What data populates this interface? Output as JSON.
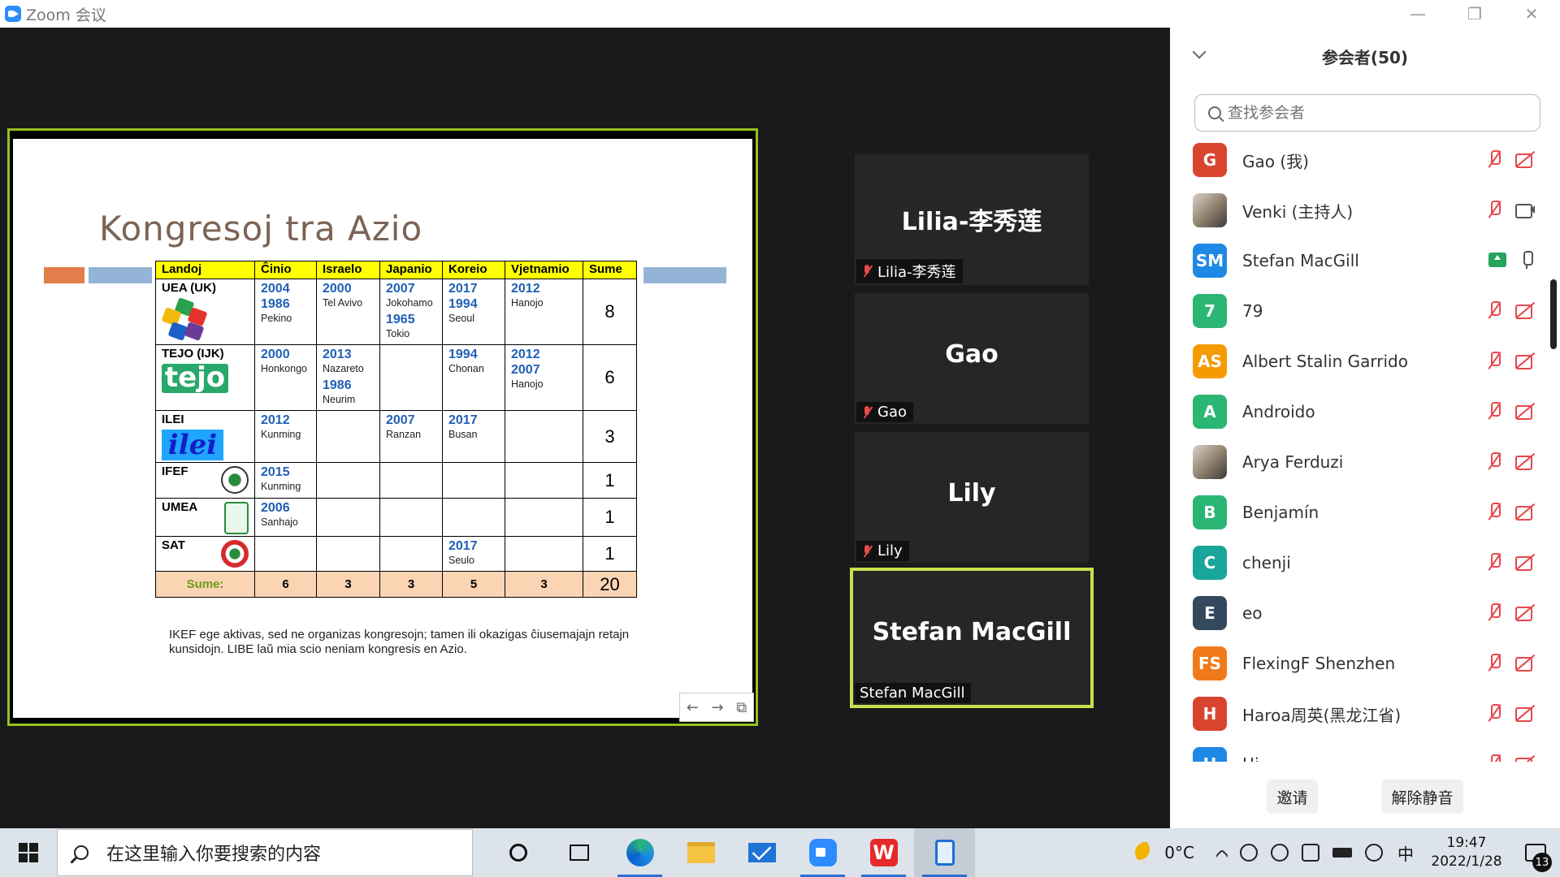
{
  "window": {
    "title": "Zoom 会议"
  },
  "slide": {
    "title": "Kongresoj tra Azio",
    "headers": [
      "Landoj",
      "Ĉinio",
      "Israelo",
      "Japanio",
      "Koreio",
      "Vjetnamio",
      "Sume"
    ],
    "rows": [
      {
        "org": "UEA (UK)",
        "cinio": [
          [
            "2004",
            ""
          ],
          [
            "1986",
            "Pekino"
          ]
        ],
        "israelo": [
          [
            "2000",
            "Tel Avivo"
          ]
        ],
        "japanio": [
          [
            "2007",
            "Jokohamo"
          ],
          [
            "1965",
            "Tokio"
          ]
        ],
        "koreio": [
          [
            "2017",
            ""
          ],
          [
            "1994",
            "Seoul"
          ]
        ],
        "vjetnamio": [
          [
            "2012",
            "Hanojo"
          ]
        ],
        "sume": "8"
      },
      {
        "org": "TEJO (IJK)",
        "logo_text": "tejo",
        "cinio": [
          [
            "2000",
            "Honkongo"
          ]
        ],
        "israelo": [
          [
            "2013",
            "Nazareto"
          ],
          [
            "1986",
            "Neurim"
          ]
        ],
        "japanio": [],
        "koreio": [
          [
            "1994",
            "Chonan"
          ]
        ],
        "vjetnamio": [
          [
            "2012",
            ""
          ],
          [
            "2007",
            "Hanojo"
          ]
        ],
        "sume": "6"
      },
      {
        "org": "ILEI",
        "logo_text": "ilei",
        "cinio": [
          [
            "2012",
            "Kunming"
          ]
        ],
        "israelo": [],
        "japanio": [
          [
            "2007",
            "Ranzan"
          ]
        ],
        "koreio": [
          [
            "2017",
            "Busan"
          ]
        ],
        "vjetnamio": [],
        "sume": "3"
      },
      {
        "org": "IFEF",
        "cinio": [
          [
            "2015",
            "Kunming"
          ]
        ],
        "israelo": [],
        "japanio": [],
        "koreio": [],
        "vjetnamio": [],
        "sume": "1"
      },
      {
        "org": "UMEA",
        "cinio": [
          [
            "2006",
            "Sanhajo"
          ]
        ],
        "israelo": [],
        "japanio": [],
        "koreio": [],
        "vjetnamio": [],
        "sume": "1"
      },
      {
        "org": "SAT",
        "cinio": [],
        "israelo": [],
        "japanio": [],
        "koreio": [
          [
            "2017",
            "Seulo"
          ]
        ],
        "vjetnamio": [],
        "sume": "1"
      }
    ],
    "totals": {
      "label": "Sume:",
      "values": [
        "6",
        "3",
        "3",
        "5",
        "3"
      ],
      "grand": "20"
    },
    "note": "IKEF ege aktivas, sed ne organizas kongresojn; tamen ili okazigas ĉiusemajajn retajn kunsidojn. LIBE laŭ mia scio neniam kongresis en Azio."
  },
  "tiles": [
    {
      "name": "Lilia-李秀莲",
      "label": "Lilia-李秀莲",
      "muted": true
    },
    {
      "name": "Gao",
      "label": "Gao",
      "muted": true
    },
    {
      "name": "Lily",
      "label": "Lily",
      "muted": true
    },
    {
      "name": "Stefan MacGill",
      "label": "Stefan MacGill",
      "muted": false
    }
  ],
  "panel": {
    "title": "参会者(50)",
    "search_placeholder": "查找参会者",
    "participants": [
      {
        "initials": "G",
        "name": "Gao (我)",
        "color": "#d9442f",
        "mic": "off",
        "cam": "off"
      },
      {
        "initials": "",
        "name": "Venki (主持人)",
        "color": "",
        "photo": true,
        "mic": "off",
        "cam": "on"
      },
      {
        "initials": "SM",
        "name": "Stefan MacGill",
        "color": "#1e88e5",
        "mic": "on",
        "cam": "share"
      },
      {
        "initials": "7",
        "name": "79",
        "color": "#2bb673",
        "mic": "off",
        "cam": "off"
      },
      {
        "initials": "AS",
        "name": "Albert Stalin Garrido",
        "color": "#f59b00",
        "mic": "off",
        "cam": "off"
      },
      {
        "initials": "A",
        "name": "Androido",
        "color": "#2bb673",
        "mic": "off",
        "cam": "off"
      },
      {
        "initials": "",
        "name": "Arya Ferduzi",
        "color": "",
        "photo": true,
        "mic": "off",
        "cam": "off"
      },
      {
        "initials": "B",
        "name": "Benjamín",
        "color": "#2bb673",
        "mic": "off",
        "cam": "off"
      },
      {
        "initials": "C",
        "name": "chenji",
        "color": "#1aa59a",
        "mic": "off",
        "cam": "off"
      },
      {
        "initials": "E",
        "name": "eo",
        "color": "#34495e",
        "mic": "off",
        "cam": "off"
      },
      {
        "initials": "FS",
        "name": "FlexingF Shenzhen",
        "color": "#f07a1a",
        "mic": "off",
        "cam": "off"
      },
      {
        "initials": "H",
        "name": "Haroa周英(黑龙江省)",
        "color": "#d9442f",
        "mic": "off",
        "cam": "off"
      },
      {
        "initials": "H",
        "name": "Hi...",
        "color": "#1e88e5",
        "mic": "off",
        "cam": "off"
      }
    ],
    "invite_label": "邀请",
    "unmute_label": "解除静音"
  },
  "taskbar": {
    "search_placeholder": "在这里输入你要搜索的内容",
    "temperature": "0°C",
    "ime": "中",
    "time": "19:47",
    "date": "2022/1/28",
    "notifications": "13"
  }
}
